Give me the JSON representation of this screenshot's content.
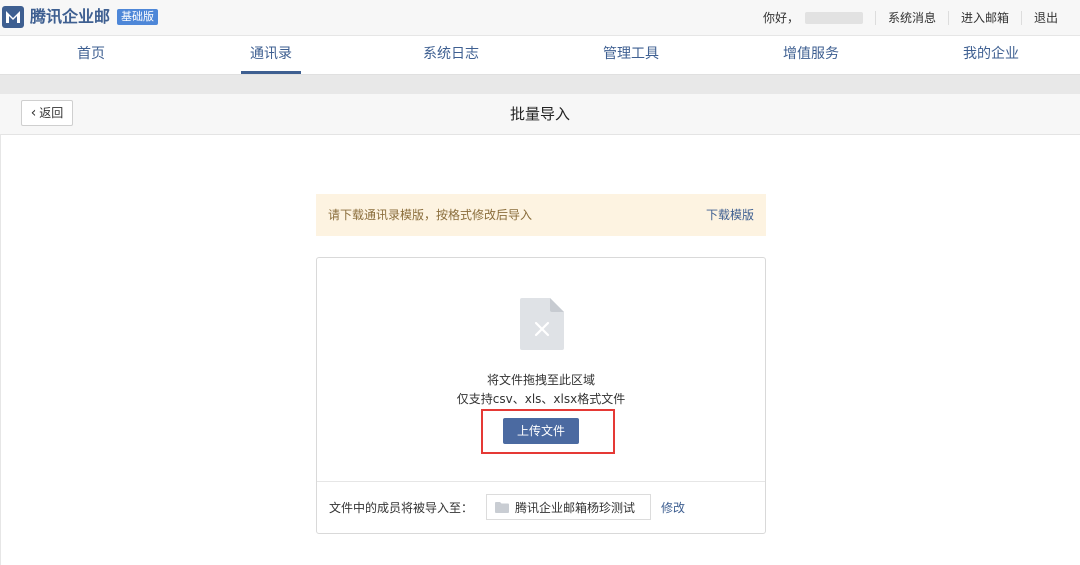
{
  "header": {
    "brand": "腾讯企业邮",
    "edition": "基础版",
    "greeting": "你好，",
    "links": [
      "系统消息",
      "进入邮箱",
      "退出"
    ]
  },
  "nav": {
    "tabs": [
      "首页",
      "通讯录",
      "系统日志",
      "管理工具",
      "增值服务",
      "我的企业"
    ],
    "active": "通讯录"
  },
  "subheader": {
    "back_label": "返回",
    "title": "批量导入"
  },
  "notice": {
    "text": "请下载通讯录模版，按格式修改后导入",
    "link": "下载模版"
  },
  "upload": {
    "drop_hint": "将文件拖拽至此区域",
    "formats_hint": "仅支持csv、xls、xlsx格式文件",
    "button_label": "上传文件",
    "destination_label": "文件中的成员将被导入至：",
    "destination_value": "腾讯企业邮箱杨珍测试",
    "modify_label": "修改"
  },
  "colors": {
    "accent": "#3e5f91",
    "button": "#4b6aa1",
    "highlight": "#e53935",
    "notice_bg": "#fdf3e1"
  },
  "icons": [
    "logo-icon",
    "chevron-left-icon",
    "file-x-icon",
    "folder-icon"
  ]
}
